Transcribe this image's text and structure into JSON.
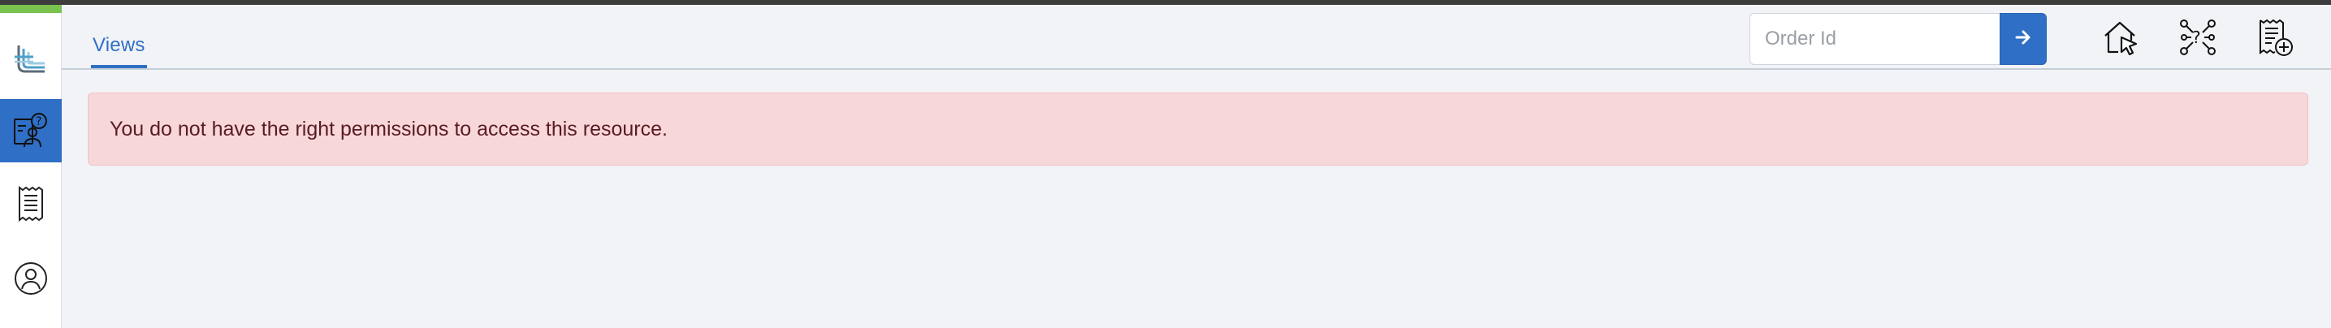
{
  "tabs": [
    {
      "label": "Views",
      "active": true
    }
  ],
  "order_search": {
    "placeholder": "Order Id",
    "value": ""
  },
  "alert": {
    "message": "You do not have the right permissions to access this resource.",
    "type": "danger"
  },
  "sidebar": {
    "items": [
      {
        "icon": "logo-icon",
        "active": false
      },
      {
        "icon": "help-desk-icon",
        "active": true
      },
      {
        "icon": "receipt-icon",
        "active": false
      },
      {
        "icon": "user-circle-icon",
        "active": false
      }
    ]
  },
  "header_icons": [
    "home-cursor-icon",
    "network-question-icon",
    "receipt-add-icon",
    "user-icon"
  ],
  "colors": {
    "accent": "#2f6fc6",
    "top_bar": "#3d3d3d",
    "green_accent": "#79c24e",
    "alert_bg": "#f7d7da",
    "alert_text": "#5a1c22",
    "background": "#f2f3f7"
  }
}
